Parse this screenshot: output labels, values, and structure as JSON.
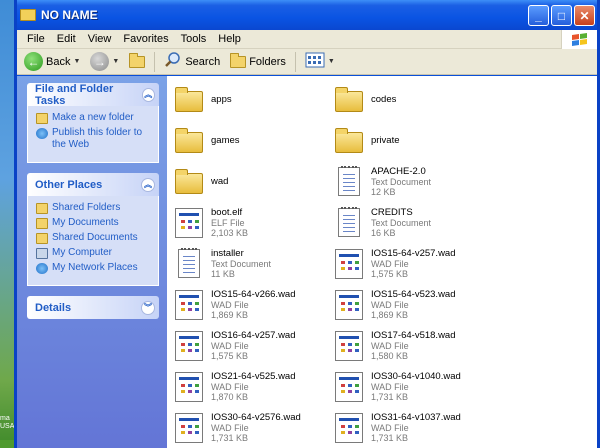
{
  "window": {
    "title": "NO NAME"
  },
  "desktop": {
    "edge_text": "ma\nUSA)"
  },
  "menubar": [
    "File",
    "Edit",
    "View",
    "Favorites",
    "Tools",
    "Help"
  ],
  "toolbar": {
    "back": "Back",
    "search": "Search",
    "folders": "Folders"
  },
  "taskpane": {
    "file_folder_tasks": {
      "title": "File and Folder Tasks",
      "items": [
        "Make a new folder",
        "Publish this folder to the Web"
      ]
    },
    "other_places": {
      "title": "Other Places",
      "items": [
        "Shared Folders",
        "My Documents",
        "Shared Documents",
        "My Computer",
        "My Network Places"
      ]
    },
    "details": {
      "title": "Details"
    }
  },
  "files": [
    {
      "name": "apps",
      "kind": "folder"
    },
    {
      "name": "codes",
      "kind": "folder"
    },
    {
      "name": "games",
      "kind": "folder"
    },
    {
      "name": "private",
      "kind": "folder"
    },
    {
      "name": "wad",
      "kind": "folder"
    },
    {
      "name": "APACHE-2.0",
      "type": "Text Document",
      "size": "12 KB",
      "kind": "text"
    },
    {
      "name": "boot.elf",
      "type": "ELF File",
      "size": "2,103 KB",
      "kind": "file"
    },
    {
      "name": "CREDITS",
      "type": "Text Document",
      "size": "16 KB",
      "kind": "text"
    },
    {
      "name": "installer",
      "type": "Text Document",
      "size": "11 KB",
      "kind": "text"
    },
    {
      "name": "IOS15-64-v257.wad",
      "type": "WAD File",
      "size": "1,575 KB",
      "kind": "wad"
    },
    {
      "name": "IOS15-64-v266.wad",
      "type": "WAD File",
      "size": "1,869 KB",
      "kind": "wad"
    },
    {
      "name": "IOS15-64-v523.wad",
      "type": "WAD File",
      "size": "1,869 KB",
      "kind": "wad"
    },
    {
      "name": "IOS16-64-v257.wad",
      "type": "WAD File",
      "size": "1,575 KB",
      "kind": "wad"
    },
    {
      "name": "IOS17-64-v518.wad",
      "type": "WAD File",
      "size": "1,580 KB",
      "kind": "wad"
    },
    {
      "name": "IOS21-64-v525.wad",
      "type": "WAD File",
      "size": "1,870 KB",
      "kind": "wad"
    },
    {
      "name": "IOS30-64-v1040.wad",
      "type": "WAD File",
      "size": "1,731 KB",
      "kind": "wad"
    },
    {
      "name": "IOS30-64-v2576.wad",
      "type": "WAD File",
      "size": "1,731 KB",
      "kind": "wad"
    },
    {
      "name": "IOS31-64-v1037.wad",
      "type": "WAD File",
      "size": "1,731 KB",
      "kind": "wad"
    }
  ],
  "colors": {
    "title_bar": "#0a54e3",
    "task_link": "#215dc6",
    "task_pane": "#6f8ce0",
    "folder": "#f3d36a"
  }
}
